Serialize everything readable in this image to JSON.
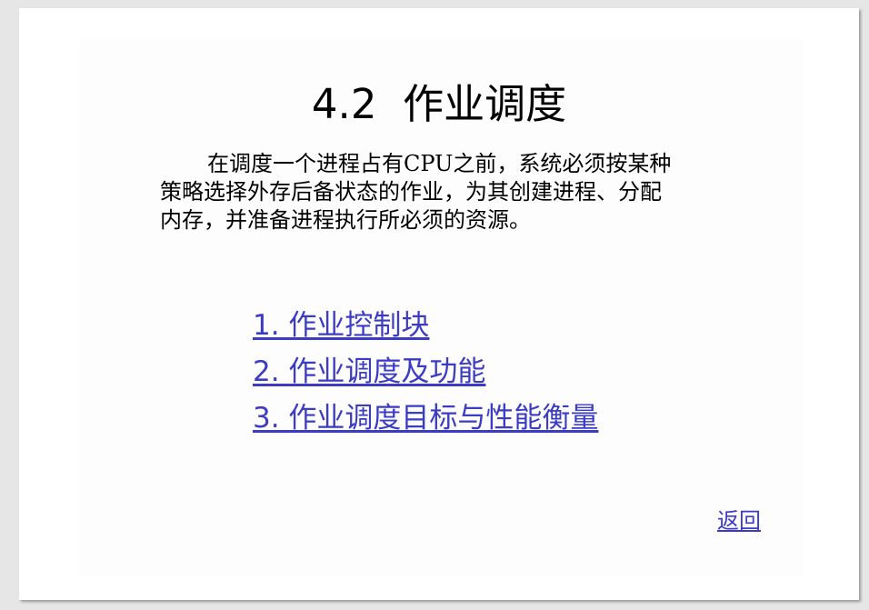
{
  "slide": {
    "title": "4.2  作业调度",
    "paragraph_lines": [
      "在调度一个进程占有CPU之前，系统必须按某种",
      "策略选择外存后备状态的作业，为其创建进程、分配",
      "内存，并准备进程执行所必须的资源。"
    ],
    "links": [
      "1. 作业控制块",
      "2. 作业调度及功能",
      "3. 作业调度目标与性能衡量"
    ],
    "back_label": "返回"
  },
  "colors": {
    "link": "#3b3bc4",
    "text": "#000000",
    "background": "#ffffff",
    "frame": "#e6e6e6"
  }
}
